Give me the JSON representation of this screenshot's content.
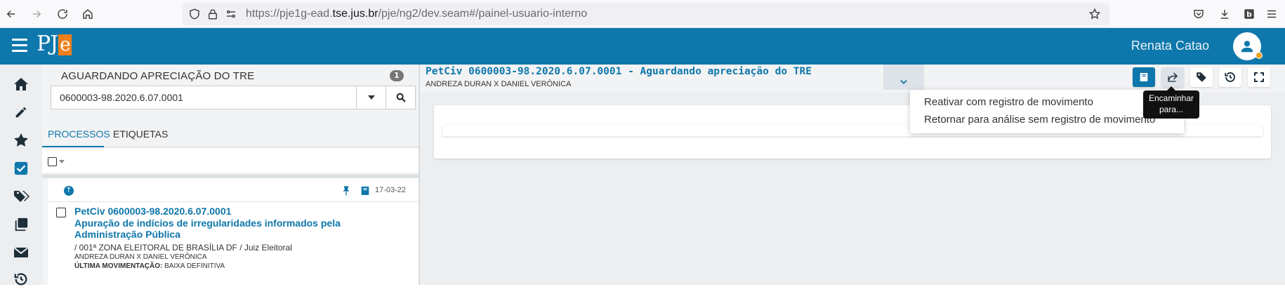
{
  "browser": {
    "url_prefix": "https://pje1g-ead.",
    "url_host": "tse.jus.br",
    "url_suffix": "/pje/ng2/dev.seam#/painel-usuario-interno"
  },
  "header": {
    "logo_text": "PJ",
    "logo_e": "e",
    "user_name": "Renata Catao"
  },
  "sidebar": {
    "icons": [
      "home-icon",
      "pencil-icon",
      "star-icon",
      "checkbox-icon",
      "tags-icon",
      "copy-icon",
      "envelope-icon",
      "history-icon"
    ]
  },
  "left_panel": {
    "title": "AGUARDANDO APRECIAÇÃO DO TRE",
    "count": "1",
    "search_value": "0600003-98.2020.6.07.0001",
    "tabs": [
      {
        "label": "PROCESSOS"
      },
      {
        "label": "ETIQUETAS"
      }
    ],
    "process": {
      "date": "17-03-22",
      "title_lines": [
        "PetCiv 0600003-98.2020.6.07.0001",
        "Apuração de indícios de irregularidades informados pela",
        "Administração Pública"
      ],
      "court": "/ 001ª ZONA ELEITORAL DE BRASÍLIA DF / Juiz Eleitoral",
      "parties": "ANDREZA DURAN X DANIEL VERÔNICA",
      "last_move_label": "ÚLTIMA MOVIMENTAÇÃO:",
      "last_move_value": " BAIXA DEFINITIVA"
    }
  },
  "case": {
    "title": "PetCiv 0600003-98.2020.6.07.0001 - Aguardando apreciação do TRE",
    "parties": "ANDREZA DURAN X DANIEL VERÔNICA"
  },
  "dropdown": {
    "items": [
      "Reativar com registro de movimento",
      "Retornar para análise sem registro de movimento"
    ]
  },
  "tooltip": {
    "line1": "Encaminhar",
    "line2": "para..."
  },
  "colors": {
    "brand": "#0e77ab",
    "logo_accent": "#f07f1b"
  }
}
